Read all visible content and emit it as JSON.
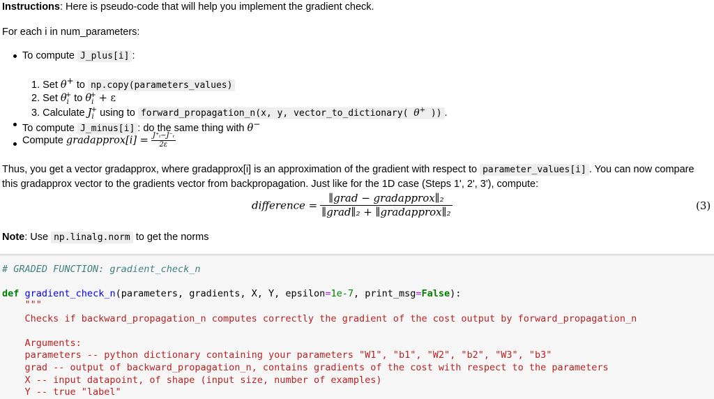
{
  "markdown": {
    "instructions_bold": "Instructions",
    "instructions_text": ": Here is pseudo-code that will help you implement the gradient check.",
    "for_each": "For each i in num_parameters:",
    "bullet1_prefix": "To compute",
    "bullet1_code": "J_plus[i]",
    "bullet1_suffix": ":",
    "step1_prefix": "1. Set",
    "step1_math": "θ",
    "step1_sup": "+",
    "step1_to": "to",
    "step1_code": "np.copy(parameters_values)",
    "step2_prefix": "2. Set",
    "step2_to": "to",
    "step2_tail": "+ ε",
    "step3_prefix": "3. Calculate",
    "step3_using": "using to",
    "step3_code_a": "forward_propagation_n(x, y, vector_to_dictionary(",
    "step3_code_b": "))",
    "step3_end": ".",
    "bullet2_prefix": "To compute",
    "bullet2_code": "J_minus[i]",
    "bullet2_suffix": ": do the same thing with",
    "bullet2_math": "θ",
    "bullet2_sup": "−",
    "bullet3_prefix": "Compute",
    "bullet3_math": "gradapprox[i] =",
    "bullet3_frac_num": "J⁺ᵢ−J⁻ᵢ",
    "bullet3_frac_den": "2ε",
    "para1_a": "Thus, you get a vector gradapprox, where gradapprox[i] is an approximation of the gradient with respect to",
    "para1_code": "parameter_values[i]",
    "para1_b": ". You can now compare",
    "para2": "this gradapprox vector to the gradients vector from backpropagation. Just like for the 1D case (Steps 1', 2', 3'), compute:",
    "eq_lhs": "difference =",
    "eq_num": "∥grad − gradapprox∥₂",
    "eq_den": "∥grad∥₂ + ∥gradapprox∥₂",
    "eq_number": "(3)",
    "note_bold": "Note",
    "note_a": ": Use",
    "note_code": "np.linalg.norm",
    "note_b": "to get the norms"
  },
  "code": {
    "comment": "# GRADED FUNCTION: gradient_check_n",
    "def_kw": "def",
    "fn_name": "gradient_check_n",
    "sig_a": "(parameters, gradients, X, Y, epsilon",
    "eq1": "=",
    "eps_val": "1e-7",
    "sig_b": ", print_msg",
    "eq2": "=",
    "false_kw": "False",
    "sig_c": "):",
    "doc_open": "    \"\"\"",
    "doc1": "    Checks if backward_propagation_n computes correctly the gradient of the cost output by forward_propagation_n",
    "doc2": "",
    "doc3": "    Arguments:",
    "doc4": "    parameters -- python dictionary containing your parameters \"W1\", \"b1\", \"W2\", \"b2\", \"W3\", \"b3\"",
    "doc5": "    grad -- output of backward_propagation_n, contains gradients of the cost with respect to the parameters",
    "doc6": "    X -- input datapoint, of shape (input size, number of examples)",
    "doc7": "    Y -- true \"label\""
  }
}
